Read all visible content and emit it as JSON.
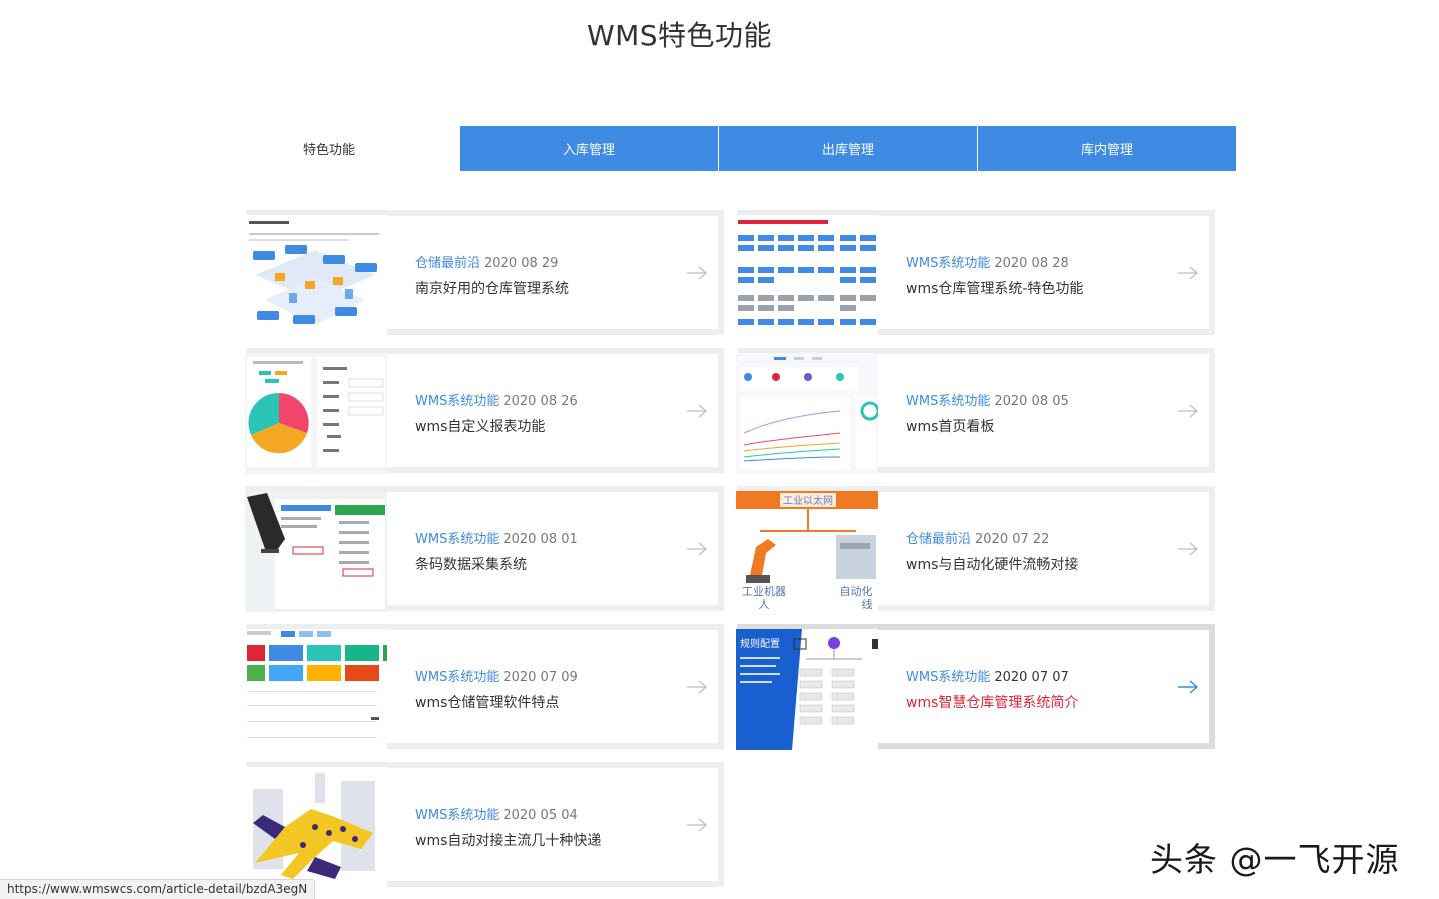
{
  "page": {
    "title": "WMS特色功能"
  },
  "tabs": [
    {
      "label": "特色功能",
      "active": false
    },
    {
      "label": "入库管理",
      "active": true
    },
    {
      "label": "出库管理",
      "active": true
    },
    {
      "label": "库内管理",
      "active": true
    }
  ],
  "articles": [
    {
      "category": "仓储最前沿",
      "date": "2020 08 29",
      "title": "南京好用的仓库管理系统",
      "thumb": "warehouse-flow-icon"
    },
    {
      "category": "WMS系统功能",
      "date": "2020 08 28",
      "title": "wms仓库管理系统-特色功能",
      "thumb": "module-grid-icon"
    },
    {
      "category": "WMS系统功能",
      "date": "2020 08 26",
      "title": "wms自定义报表功能",
      "thumb": "pie-chart-icon"
    },
    {
      "category": "WMS系统功能",
      "date": "2020 08 05",
      "title": "wms首页看板",
      "thumb": "dashboard-icon"
    },
    {
      "category": "WMS系统功能",
      "date": "2020 08 01",
      "title": "条码数据采集系统",
      "thumb": "barcode-scanner-icon"
    },
    {
      "category": "仓储最前沿",
      "date": "2020 07 22",
      "title": "wms与自动化硬件流畅对接",
      "thumb": "robot-arm-icon",
      "thumb_labels": [
        "工业以太网",
        "工业机器",
        "人",
        "自动化",
        "线"
      ]
    },
    {
      "category": "WMS系统功能",
      "date": "2020 07 09",
      "title": "wms仓储管理软件特点",
      "thumb": "tiles-dashboard-icon"
    },
    {
      "category": "WMS系统功能",
      "date": "2020 07 07",
      "title": "wms智慧仓库管理系统简介",
      "thumb": "rule-config-icon",
      "thumb_labels": [
        "规则配置"
      ],
      "hovered": true
    },
    {
      "category": "WMS系统功能",
      "date": "2020 05 04",
      "title": "wms自动对接主流几十种快递",
      "thumb": "courier-runner-icon"
    }
  ],
  "status_bar": {
    "url": "https://www.wmswcs.com/article-detail/bzdA3egN"
  },
  "watermark": {
    "text": "头条 @一飞开源"
  },
  "colors": {
    "accent": "#3f8ae2",
    "hover_title": "#e0243a",
    "card_border": "#eeeeee"
  }
}
